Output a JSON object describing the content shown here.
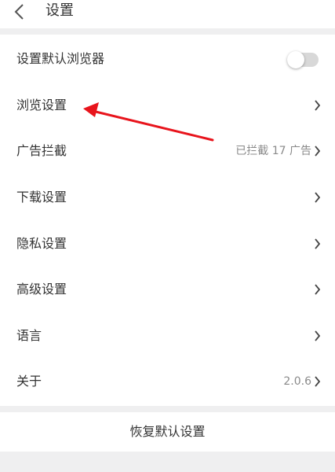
{
  "header": {
    "title": "设置",
    "back_icon": "chevron-left-icon"
  },
  "settings": {
    "default_browser": {
      "label": "设置默认浏览器",
      "toggle_on": false
    },
    "browse": {
      "label": "浏览设置"
    },
    "ad_block": {
      "label": "广告拦截",
      "value": "已拦截 17 广告"
    },
    "download": {
      "label": "下载设置"
    },
    "privacy": {
      "label": "隐私设置"
    },
    "advanced": {
      "label": "高级设置"
    },
    "language": {
      "label": "语言"
    },
    "about": {
      "label": "关于",
      "value": "2.0.6"
    }
  },
  "footer": {
    "reset_label": "恢复默认设置"
  },
  "colors": {
    "background": "#efeff0",
    "card": "#ffffff",
    "annotation_arrow": "#e8141c"
  }
}
